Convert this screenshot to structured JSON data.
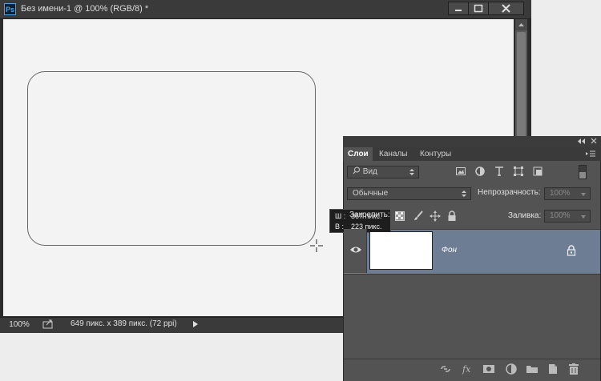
{
  "document": {
    "app_badge": "Ps",
    "title": "Без имени-1 @ 100% (RGB/8) *",
    "status": {
      "zoom": "100%",
      "doc_info": "649 пикс. x 389 пикс. (72 ppi)"
    }
  },
  "tooltip": {
    "width_key": "Ш :",
    "width_value": "367 пикс.",
    "height_key": "В :",
    "height_value": "223 пикс."
  },
  "layers_panel": {
    "tabs": [
      "Слои",
      "Каналы",
      "Контуры"
    ],
    "filter_kind": "Вид",
    "blend_mode": "Обычные",
    "opacity_label": "Непрозрачность:",
    "opacity_value": "100%",
    "lock_label": "Закрепить:",
    "fill_label": "Заливка:",
    "fill_value": "100%",
    "layers": [
      {
        "name": "Фон",
        "visible": true,
        "locked": true,
        "selected": true
      }
    ],
    "bottom_icons": [
      "link-icon",
      "fx-icon",
      "mask-icon",
      "adjustment-icon",
      "group-icon",
      "new-layer-icon",
      "delete-icon"
    ]
  },
  "colors": {
    "selected_layer": "#6d7d93",
    "panel_bg": "#535353",
    "canvas_bg": "#f3f3f3",
    "ps_blue": "#4aa3e0"
  }
}
